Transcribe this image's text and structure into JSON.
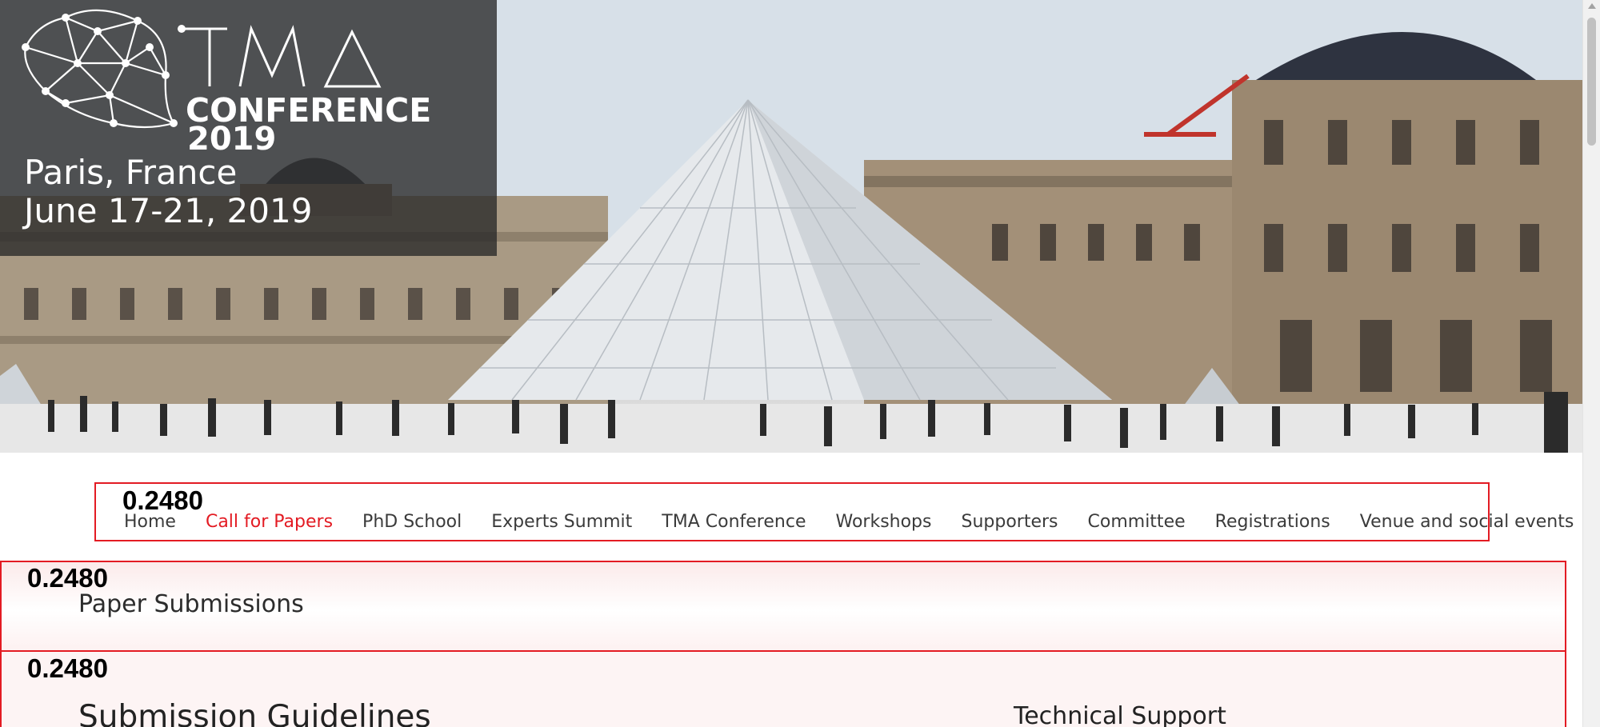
{
  "hero": {
    "logo_letters": "TMA",
    "logo_word": "CONFERENCE",
    "logo_year": "2019",
    "location": "Paris, France",
    "dates": "June 17-21, 2019"
  },
  "nav": {
    "score": "0.2480",
    "items": [
      "Home",
      "Call for Papers",
      "PhD School",
      "Experts Summit",
      "TMA Conference",
      "Workshops",
      "Supporters",
      "Committee",
      "Registrations",
      "Venue and social events"
    ],
    "active": "Call for Papers"
  },
  "section_submissions": {
    "score": "0.2480",
    "title": "Paper Submissions"
  },
  "section_guidelines": {
    "score": "0.2480",
    "title": "Submission Guidelines",
    "side_title": "Technical Support"
  },
  "colors": {
    "accent": "#e31b23",
    "nav_text": "#3b3b3b",
    "brand_panel": "#282828"
  }
}
